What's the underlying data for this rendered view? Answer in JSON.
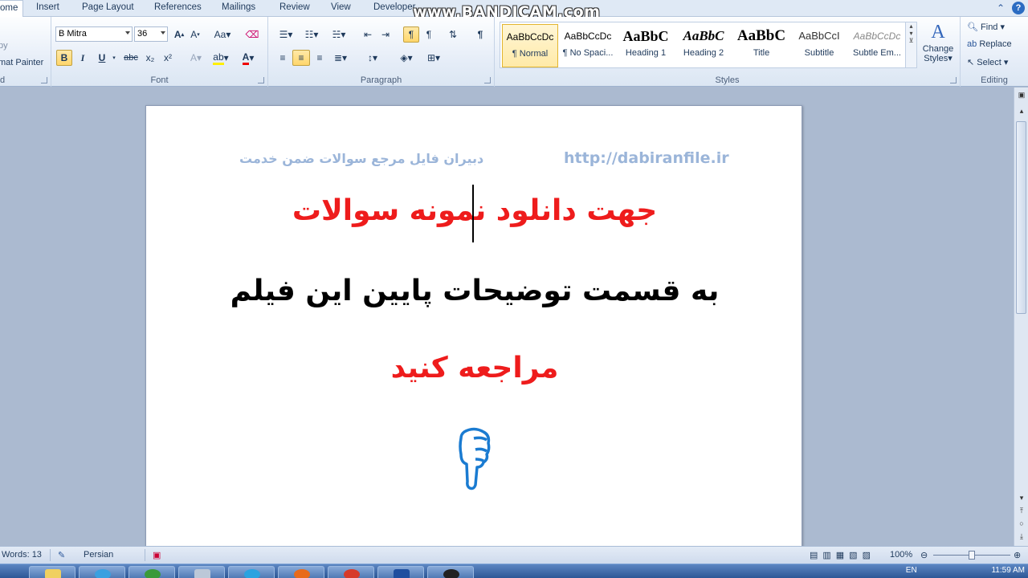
{
  "tabs": [
    "ome",
    "Insert",
    "Page Layout",
    "References",
    "Mailings",
    "Review",
    "View",
    "Developer"
  ],
  "watermark": "www.BANDICAM.com",
  "clipboard": {
    "copy_label": "py",
    "format_painter_label": "mat Painter",
    "group_label": "d"
  },
  "font": {
    "family": "B Mitra",
    "size": "36",
    "group_label": "Font",
    "buttons": [
      "B",
      "I",
      "U",
      "abc",
      "x₂",
      "x²"
    ]
  },
  "paragraph": {
    "group_label": "Paragraph",
    "pilcrow": "¶"
  },
  "styles": {
    "group_label": "Styles",
    "items": [
      {
        "preview": "AaBbCcDc",
        "name": "¶ Normal"
      },
      {
        "preview": "AaBbCcDc",
        "name": "¶ No Spaci..."
      },
      {
        "preview": "AaBbC",
        "name": "Heading 1"
      },
      {
        "preview": "AaBbC",
        "name": "Heading 2"
      },
      {
        "preview": "AaBbC",
        "name": "Title"
      },
      {
        "preview": "AaBbCcI",
        "name": "Subtitle"
      },
      {
        "preview": "AaBbCcDc",
        "name": "Subtle Em..."
      }
    ],
    "change_styles_label": "Change Styles",
    "change_styles_line1": "Change",
    "change_styles_line2": "Styles"
  },
  "editing": {
    "find": "Find",
    "replace": "Replace",
    "select": "Select",
    "group_label": "Editing"
  },
  "document": {
    "header_url": "http://dabiranfile.ir",
    "header_fa": "دبیران فایل مرجع سوالات ضمن خدمت",
    "line1": "جهت دانلود نمونه سوالات",
    "line2": "به قسمت توضیحات پایین این فیلم",
    "line3": "مراجعه کنید"
  },
  "status": {
    "words": "Words: 13",
    "language": "Persian",
    "zoom": "100%"
  },
  "tray": {
    "lang": "EN",
    "time": "11:59 AM"
  },
  "colors": {
    "red_text": "#ee1c1c",
    "header_text": "#9bb5d9",
    "pointer": "#1a7bd1"
  }
}
